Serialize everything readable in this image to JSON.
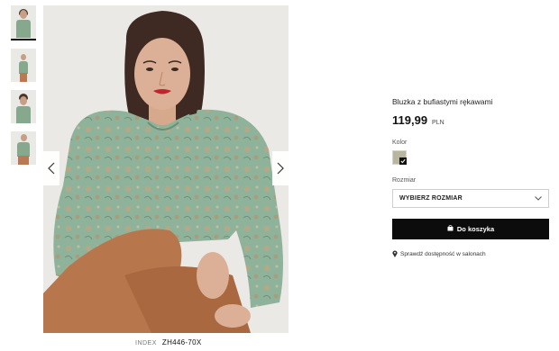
{
  "gallery": {
    "thumbnails": [
      "thumb-1",
      "thumb-2",
      "thumb-3",
      "thumb-4"
    ],
    "active_index": 0
  },
  "product": {
    "index_label": "INDEX",
    "index_value": "ZH446-70X",
    "title": "Bluzka z bufiastymi rękawami",
    "price": "119,99",
    "currency": "PLN",
    "color_label": "Kolor",
    "color_swatch": "#b9b69f",
    "size_label": "Rozmiar",
    "size_select_value": "WYBIERZ ROZMIAR",
    "cart_button": "Do koszyka",
    "store_link": "Sprawdź dostępność w salonach"
  },
  "icons": {
    "prev": "chevron-left-icon",
    "next": "chevron-right-icon",
    "dropdown": "chevron-down-icon",
    "cart": "shopping-bag-icon",
    "store": "location-pin-icon"
  }
}
